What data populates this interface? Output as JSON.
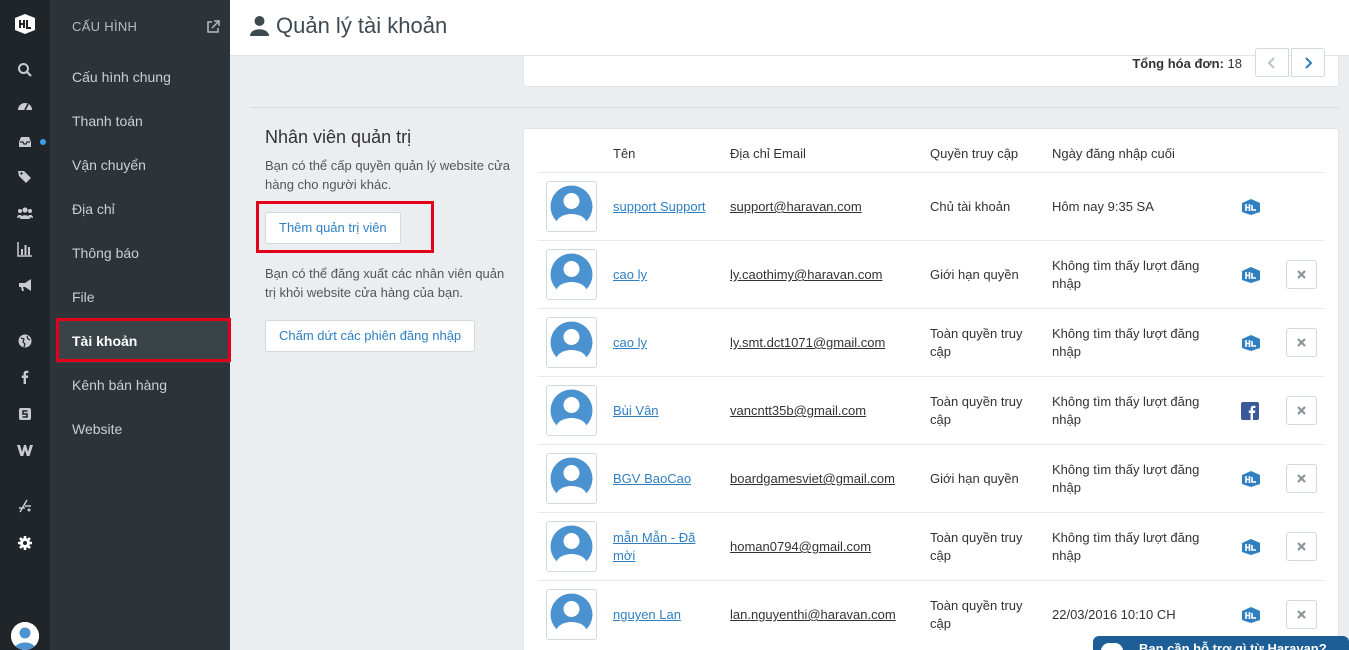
{
  "app": {
    "page_title": "Quản lý tài khoản"
  },
  "sidebar": {
    "heading": "CẤU HÌNH",
    "items": [
      {
        "label": "Cấu hình chung"
      },
      {
        "label": "Thanh toán"
      },
      {
        "label": "Vận chuyển"
      },
      {
        "label": "Địa chỉ"
      },
      {
        "label": "Thông báo"
      },
      {
        "label": "File"
      },
      {
        "label": "Tài khoản",
        "active": true
      },
      {
        "label": "Kênh bán hàng"
      },
      {
        "label": "Website"
      }
    ]
  },
  "rail": {
    "icons": [
      "search-icon",
      "dashboard-icon",
      "inbox-icon",
      "tags-icon",
      "users-icon",
      "bar-chart-icon",
      "bullhorn-icon",
      "globe-icon",
      "facebook-icon",
      "shopee-icon",
      "web-icon",
      "fork-icon",
      "settings-icon"
    ]
  },
  "pagination": {
    "total_label": "Tổng hóa đơn:",
    "total_value": "18"
  },
  "admins": {
    "title": "Nhân viên quản trị",
    "desc1": "Bạn có thể cấp quyền quản lý website cửa hàng cho người khác.",
    "add_button": "Thêm quản trị viên",
    "desc2": "Bạn có thể đăng xuất các nhân viên quản trị khỏi website cửa hàng của bạn.",
    "end_sessions_button": "Chấm dứt các phiên đăng nhập"
  },
  "table": {
    "headers": {
      "name": "Tên",
      "email": "Địa chỉ Email",
      "perm": "Quyền truy cập",
      "last": "Ngày đăng nhập cuối"
    },
    "rows": [
      {
        "name": "support Support",
        "suffix": "",
        "email": "support@haravan.com",
        "perm": "Chủ tài khoản",
        "last": "Hôm nay 9:35 SA",
        "source": "haravan-icon",
        "deletable": false
      },
      {
        "name": "cao ly",
        "suffix": "",
        "email": "ly.caothimy@haravan.com",
        "perm": "Giới hạn quyền",
        "last": "Không tìm thấy lượt đăng nhập",
        "source": "haravan-icon",
        "deletable": true
      },
      {
        "name": "cao ly",
        "suffix": "",
        "email": "ly.smt.dct1071@gmail.com",
        "perm": "Toàn quyền truy cập",
        "last": "Không tìm thấy lượt đăng nhập",
        "source": "haravan-icon",
        "deletable": true
      },
      {
        "name": "Bùi Vân",
        "suffix": "",
        "email": "vancntt35b@gmail.com",
        "perm": "Toàn quyền truy cập",
        "last": "Không tìm thấy lượt đăng nhập",
        "source": "facebook-icon",
        "deletable": true
      },
      {
        "name": "BGV BaoCao",
        "suffix": "",
        "email": "boardgamesviet@gmail.com",
        "perm": "Giới hạn quyền",
        "last": "Không tìm thấy lượt đăng nhập",
        "source": "haravan-icon",
        "deletable": true
      },
      {
        "name": "mẫn Mẫn",
        "suffix": "- Đã mời",
        "email": "homan0794@gmail.com",
        "perm": "Toàn quyền truy cập",
        "last": "Không tìm thấy lượt đăng nhập",
        "source": "haravan-icon",
        "deletable": true
      },
      {
        "name": "nguyen Lan",
        "suffix": "",
        "email": "lan.nguyenthi@haravan.com",
        "perm": "Toàn quyền truy cập",
        "last": "22/03/2016 10:10 CH",
        "source": "haravan-icon",
        "deletable": true
      }
    ]
  },
  "chat": {
    "label": "Bạn cần hỗ trợ gì từ Haravan?"
  },
  "colors": {
    "accent": "#2f7fc1",
    "sidebar": "#2c3439",
    "rail": "#1f2528",
    "highlight": "#e3001b"
  }
}
